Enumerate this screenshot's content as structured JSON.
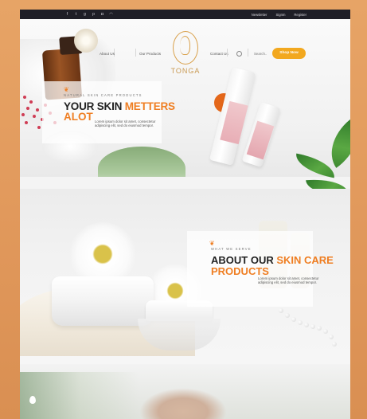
{
  "topbar": {
    "socials": [
      {
        "icon": "facebook-icon",
        "glyph": "f"
      },
      {
        "icon": "twitter-icon",
        "glyph": "t"
      },
      {
        "icon": "google-plus-icon",
        "glyph": "g"
      },
      {
        "icon": "pinterest-icon",
        "glyph": "p"
      },
      {
        "icon": "instagram-icon",
        "glyph": "◘"
      },
      {
        "icon": "rss-icon",
        "glyph": "◠"
      }
    ],
    "newsletter": "Newsletter",
    "signin": "SignIn",
    "register": "Register"
  },
  "nav": {
    "about": "About Us",
    "products": "Our Products",
    "contact": "Contact Us",
    "brand": "TONGA",
    "search_placeholder": "Search..",
    "shop_now": "Shop Now"
  },
  "hero": {
    "eyebrow": "NATURAL SKIN CARE PRODUCTS",
    "title_line1_dark": "YOUR SKIN ",
    "title_line1_accent": "METTERS",
    "title_line2": "ALOT",
    "description": "Lorem ipsum dolor sit amet, consectetur adipiscing elit, sed do eiusmod tempor."
  },
  "about": {
    "eyebrow": "WHAT WE SERVE",
    "title_line1_dark": "ABOUT OUR ",
    "title_line1_accent": "SKIN CARE",
    "title_line2": "PRODUCTS",
    "description": "Lorem ipsum dolor sit amet, consectetur adipiscing elit, sed do eiusmod tempor."
  },
  "colors": {
    "accent": "#ef7e22",
    "button": "#f2a81f",
    "topbar": "#1e1e26",
    "frame": "#e0975a"
  }
}
